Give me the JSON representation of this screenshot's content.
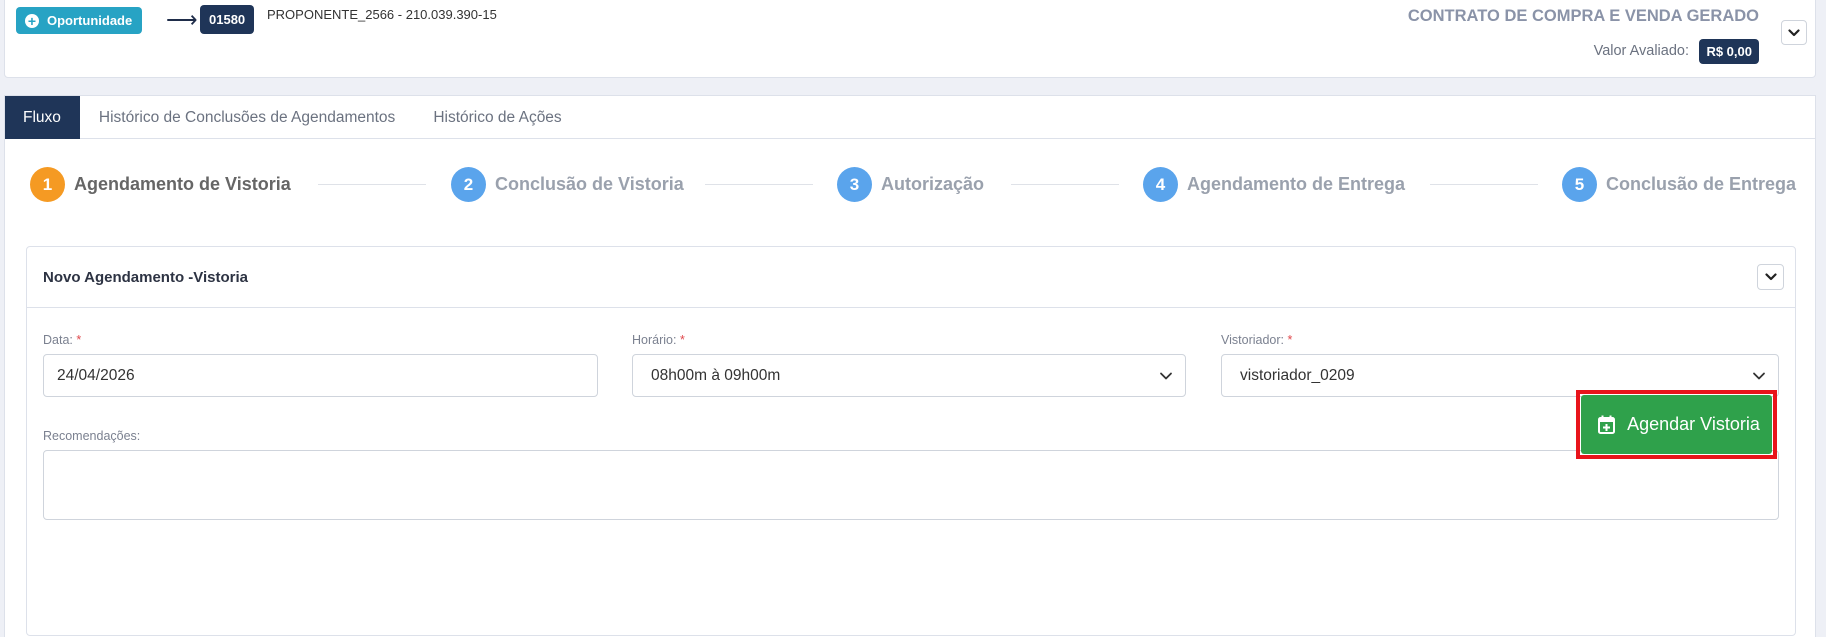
{
  "header": {
    "opportunity_label": "Oportunidade",
    "arrow_glyph": "⟶",
    "record_number": "01580",
    "proponent": "PROPONENTE_2566 - 210.039.390-15",
    "status": "CONTRATO DE COMPRA E VENDA GERADO",
    "valor_label": "Valor Avaliado:",
    "valor_value": "R$ 0,00"
  },
  "tabs": [
    {
      "label": "Fluxo",
      "active": true
    },
    {
      "label": "Histórico de Conclusões de Agendamentos",
      "active": false
    },
    {
      "label": "Histórico de Ações",
      "active": false
    }
  ],
  "steps": [
    {
      "number": "1",
      "label": "Agendamento de Vistoria",
      "state": "active"
    },
    {
      "number": "2",
      "label": "Conclusão de Vistoria",
      "state": "pending"
    },
    {
      "number": "3",
      "label": "Autorização",
      "state": "pending"
    },
    {
      "number": "4",
      "label": "Agendamento de Entrega",
      "state": "pending"
    },
    {
      "number": "5",
      "label": "Conclusão de Entrega",
      "state": "pending"
    }
  ],
  "form": {
    "title": "Novo Agendamento -Vistoria",
    "data_label": "Data:",
    "data_value": "24/04/2026",
    "horario_label": "Horário:",
    "horario_value": "08h00m à 09h00m",
    "vistoriador_label": "Vistoriador:",
    "vistoriador_value": "vistoriador_0209",
    "required_mark": "*",
    "recomendacoes_label": "Recomendações:",
    "recomendacoes_value": "",
    "submit_label": "Agendar Vistoria"
  },
  "colors": {
    "navy": "#1f3558",
    "teal": "#27a3c4",
    "step_active": "#f59a23",
    "step_pending": "#5aa4ec",
    "success": "#2fa14b",
    "highlight": "#e8141b"
  },
  "icons": [
    "plus-circle-icon",
    "arrow-right-icon",
    "chevron-down-icon",
    "calendar-plus-icon",
    "resize-handle-icon"
  ]
}
